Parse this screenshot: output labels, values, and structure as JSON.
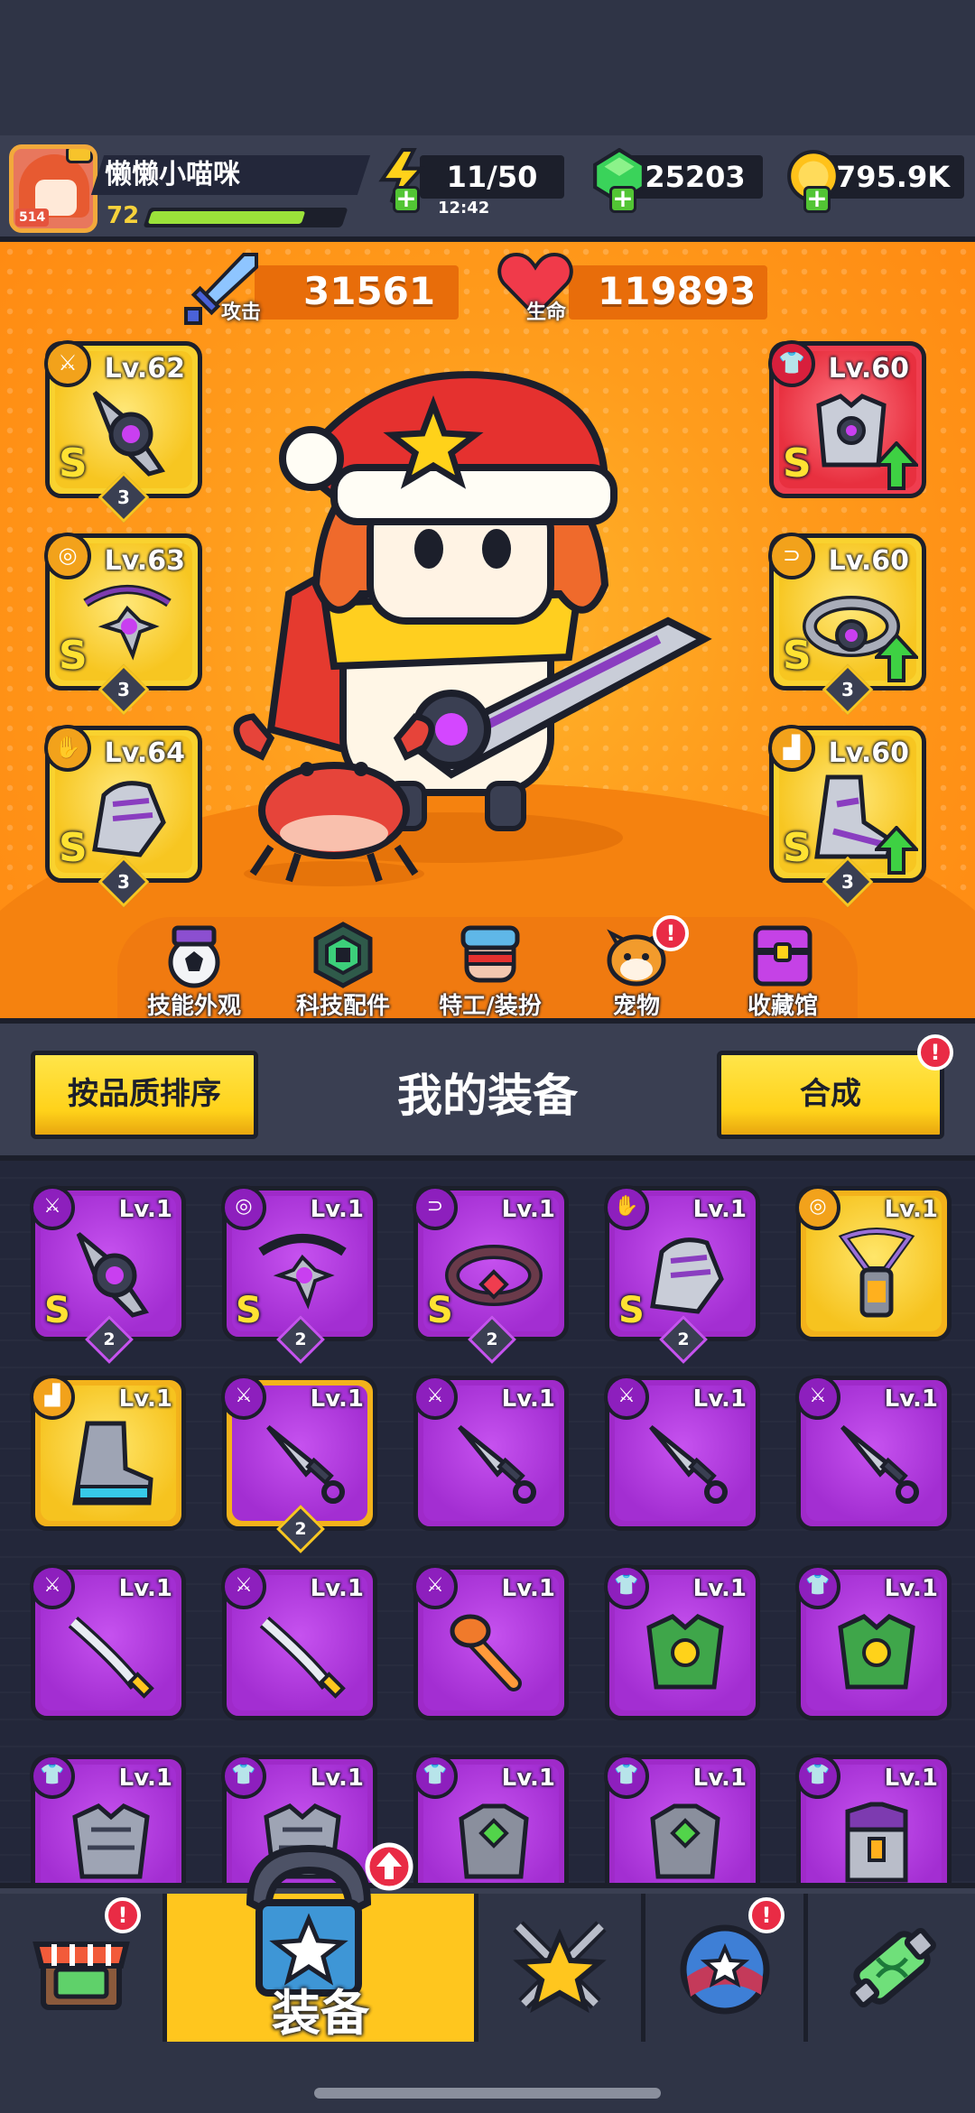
{
  "player": {
    "name": "懒懒小喵咪",
    "level": "72",
    "avatar_badge": "514",
    "xp_fraction": 0.8
  },
  "resources": {
    "energy": "11/50",
    "energy_timer": "12:42",
    "gems": "25203",
    "gold": "795.9K"
  },
  "stats": {
    "attack_label": "攻击",
    "attack_value": "31561",
    "hp_label": "生命",
    "hp_value": "119893"
  },
  "equipped": {
    "left": [
      {
        "level": "Lv.62",
        "rank": "S",
        "stars": "3",
        "type_icon": "weapon-icon"
      },
      {
        "level": "Lv.63",
        "rank": "S",
        "stars": "3",
        "type_icon": "necklace-icon"
      },
      {
        "level": "Lv.64",
        "rank": "S",
        "stars": "3",
        "type_icon": "glove-icon"
      }
    ],
    "right": [
      {
        "level": "Lv.60",
        "rank": "S",
        "type_icon": "armor-icon",
        "upgradable": true
      },
      {
        "level": "Lv.60",
        "rank": "S",
        "stars": "3",
        "type_icon": "belt-icon",
        "upgradable": true
      },
      {
        "level": "Lv.60",
        "rank": "S",
        "stars": "3",
        "type_icon": "boots-icon",
        "upgradable": true
      }
    ]
  },
  "menu": [
    {
      "label": "技能外观"
    },
    {
      "label": "科技配件"
    },
    {
      "label": "特工/装扮"
    },
    {
      "label": "宠物",
      "alert": "!"
    },
    {
      "label": "收藏馆"
    }
  ],
  "toolbar": {
    "sort_label": "按品质排序",
    "title": "我的装备",
    "merge_label": "合成",
    "merge_alert": "!"
  },
  "inventory": [
    {
      "level": "Lv.1",
      "rank": "S",
      "stars": "2",
      "quality": "purple",
      "type_icon": "weapon-icon",
      "item": "pinwheel-blade"
    },
    {
      "level": "Lv.1",
      "rank": "S",
      "stars": "2",
      "quality": "purple",
      "type_icon": "necklace-icon",
      "item": "spike-necklace"
    },
    {
      "level": "Lv.1",
      "rank": "S",
      "stars": "2",
      "quality": "purple",
      "type_icon": "belt-icon",
      "item": "ruby-belt"
    },
    {
      "level": "Lv.1",
      "rank": "S",
      "stars": "2",
      "quality": "purple",
      "type_icon": "glove-icon",
      "item": "armored-glove"
    },
    {
      "level": "Lv.1",
      "quality": "gold",
      "type_icon": "necklace-icon",
      "item": "lantern-amulet"
    },
    {
      "level": "Lv.1",
      "quality": "gold",
      "type_icon": "boots-icon",
      "item": "tech-boots"
    },
    {
      "level": "Lv.1",
      "stars": "2",
      "quality": "purple-goldrim",
      "type_icon": "weapon-icon",
      "item": "kunai"
    },
    {
      "level": "Lv.1",
      "quality": "purple",
      "type_icon": "weapon-icon",
      "item": "kunai"
    },
    {
      "level": "Lv.1",
      "quality": "purple",
      "type_icon": "weapon-icon",
      "item": "kunai"
    },
    {
      "level": "Lv.1",
      "quality": "purple",
      "type_icon": "weapon-icon",
      "item": "kunai"
    },
    {
      "level": "Lv.1",
      "quality": "purple",
      "type_icon": "weapon-icon",
      "item": "katana"
    },
    {
      "level": "Lv.1",
      "quality": "purple",
      "type_icon": "weapon-icon",
      "item": "katana"
    },
    {
      "level": "Lv.1",
      "quality": "purple",
      "type_icon": "weapon-icon",
      "item": "bat"
    },
    {
      "level": "Lv.1",
      "quality": "purple",
      "type_icon": "armor-icon",
      "item": "leaf-armor"
    },
    {
      "level": "Lv.1",
      "quality": "purple",
      "type_icon": "armor-icon",
      "item": "leaf-armor"
    },
    {
      "level": "Lv.1",
      "quality": "purple",
      "type_icon": "armor-icon",
      "item": "steel-armor"
    },
    {
      "level": "Lv.1",
      "quality": "purple",
      "type_icon": "armor-icon",
      "item": "steel-armor"
    },
    {
      "level": "Lv.1",
      "quality": "purple",
      "type_icon": "armor-icon",
      "item": "gem-armor"
    },
    {
      "level": "Lv.1",
      "quality": "purple",
      "type_icon": "armor-icon",
      "item": "gem-armor"
    },
    {
      "level": "Lv.1",
      "quality": "purple",
      "type_icon": "armor-icon",
      "item": "vest-armor"
    }
  ],
  "bottom_nav": [
    {
      "name": "shop",
      "alert": "!"
    },
    {
      "name": "equipment",
      "label": "装备",
      "active": true
    },
    {
      "name": "battle"
    },
    {
      "name": "challenge",
      "alert": "!"
    },
    {
      "name": "evolve"
    }
  ]
}
